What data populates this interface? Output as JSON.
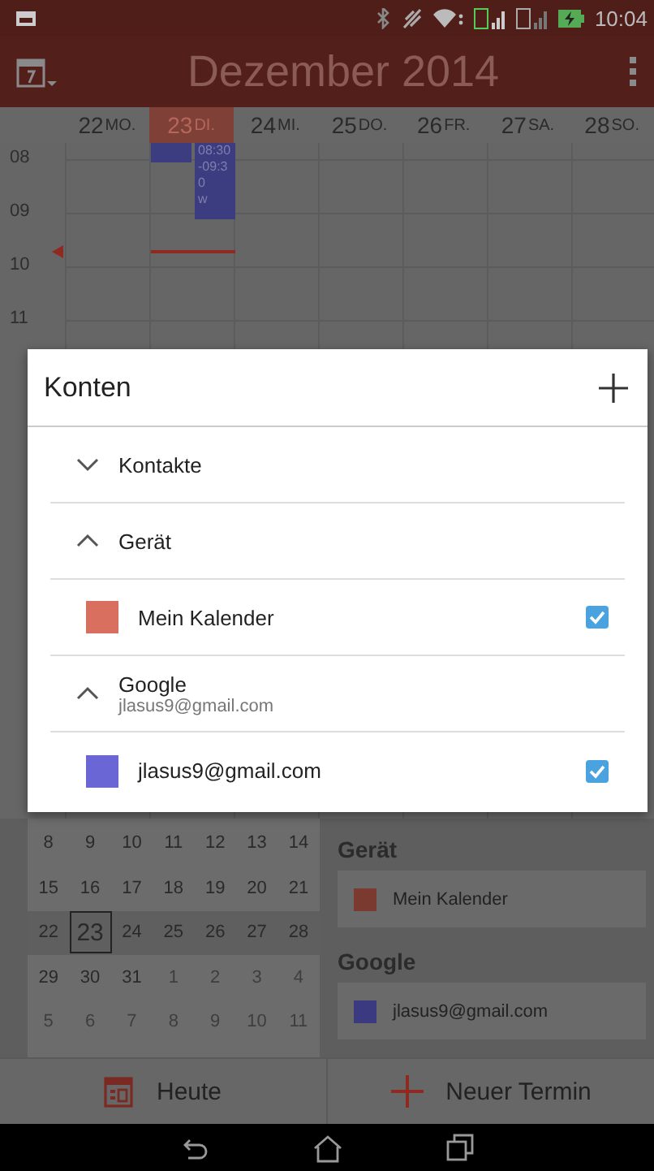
{
  "status_bar": {
    "time": "10:04"
  },
  "toolbar": {
    "title": "Dezember 2014"
  },
  "week_header": {
    "days": [
      {
        "number": "22",
        "weekday": "MO.",
        "selected": false
      },
      {
        "number": "23",
        "weekday": "DI.",
        "selected": true
      },
      {
        "number": "24",
        "weekday": "MI.",
        "selected": false
      },
      {
        "number": "25",
        "weekday": "DO.",
        "selected": false
      },
      {
        "number": "26",
        "weekday": "FR.",
        "selected": false
      },
      {
        "number": "27",
        "weekday": "SA.",
        "selected": false
      },
      {
        "number": "28",
        "weekday": "SO.",
        "selected": false
      }
    ]
  },
  "time_grid": {
    "hours": [
      "08",
      "09",
      "10",
      "11"
    ],
    "events": [
      {
        "kind": "block"
      },
      {
        "kind": "block",
        "lines": [
          "08:30",
          "-09:3",
          "0",
          "w"
        ]
      }
    ]
  },
  "dialog": {
    "title": "Konten",
    "rows": [
      {
        "kind": "group",
        "label": "Kontakte",
        "expanded": false
      },
      {
        "kind": "group",
        "label": "Gerät",
        "expanded": true
      },
      {
        "kind": "calendar",
        "label": "Mein Kalender",
        "color": "#d9705f",
        "checked": true
      },
      {
        "kind": "group",
        "label": "Google",
        "sublabel": "jlasus9@gmail.com",
        "expanded": true
      },
      {
        "kind": "calendar",
        "label": "jlasus9@gmail.com",
        "color": "#6b66d6",
        "checked": true
      }
    ]
  },
  "mini_calendar": {
    "weeks": [
      {
        "selected": false,
        "days": [
          {
            "label": "8",
            "muted": false,
            "selected": false
          },
          {
            "label": "9",
            "muted": false,
            "selected": false
          },
          {
            "label": "10",
            "muted": false,
            "selected": false
          },
          {
            "label": "11",
            "muted": false,
            "selected": false
          },
          {
            "label": "12",
            "muted": false,
            "selected": false
          },
          {
            "label": "13",
            "muted": false,
            "selected": false
          },
          {
            "label": "14",
            "muted": false,
            "selected": false
          }
        ]
      },
      {
        "selected": false,
        "days": [
          {
            "label": "15",
            "muted": false,
            "selected": false
          },
          {
            "label": "16",
            "muted": false,
            "selected": false
          },
          {
            "label": "17",
            "muted": false,
            "selected": false
          },
          {
            "label": "18",
            "muted": false,
            "selected": false
          },
          {
            "label": "19",
            "muted": false,
            "selected": false
          },
          {
            "label": "20",
            "muted": false,
            "selected": false
          },
          {
            "label": "21",
            "muted": false,
            "selected": false
          }
        ]
      },
      {
        "selected": true,
        "days": [
          {
            "label": "22",
            "muted": false,
            "selected": false
          },
          {
            "label": "23",
            "muted": false,
            "selected": true
          },
          {
            "label": "24",
            "muted": false,
            "selected": false
          },
          {
            "label": "25",
            "muted": false,
            "selected": false
          },
          {
            "label": "26",
            "muted": false,
            "selected": false
          },
          {
            "label": "27",
            "muted": false,
            "selected": false
          },
          {
            "label": "28",
            "muted": false,
            "selected": false
          }
        ]
      },
      {
        "selected": false,
        "days": [
          {
            "label": "29",
            "muted": false,
            "selected": false
          },
          {
            "label": "30",
            "muted": false,
            "selected": false
          },
          {
            "label": "31",
            "muted": false,
            "selected": false
          },
          {
            "label": "1",
            "muted": true,
            "selected": false
          },
          {
            "label": "2",
            "muted": true,
            "selected": false
          },
          {
            "label": "3",
            "muted": true,
            "selected": false
          },
          {
            "label": "4",
            "muted": true,
            "selected": false
          }
        ]
      },
      {
        "selected": false,
        "days": [
          {
            "label": "5",
            "muted": true,
            "selected": false
          },
          {
            "label": "6",
            "muted": true,
            "selected": false
          },
          {
            "label": "7",
            "muted": true,
            "selected": false
          },
          {
            "label": "8",
            "muted": true,
            "selected": false
          },
          {
            "label": "9",
            "muted": true,
            "selected": false
          },
          {
            "label": "10",
            "muted": true,
            "selected": false
          },
          {
            "label": "11",
            "muted": true,
            "selected": false
          }
        ]
      }
    ]
  },
  "calendar_list": {
    "sections": [
      {
        "heading": "Gerät",
        "calendars": [
          {
            "name": "Mein Kalender",
            "color": "#7a3a30"
          }
        ]
      },
      {
        "heading": "Google",
        "calendars": [
          {
            "name": "jlasus9@gmail.com",
            "color": "#3b3a80"
          }
        ]
      }
    ]
  },
  "bottom_bar": {
    "buttons": [
      {
        "kind": "today",
        "label": "Heute"
      },
      {
        "kind": "new",
        "label": "Neuer Termin"
      }
    ]
  }
}
